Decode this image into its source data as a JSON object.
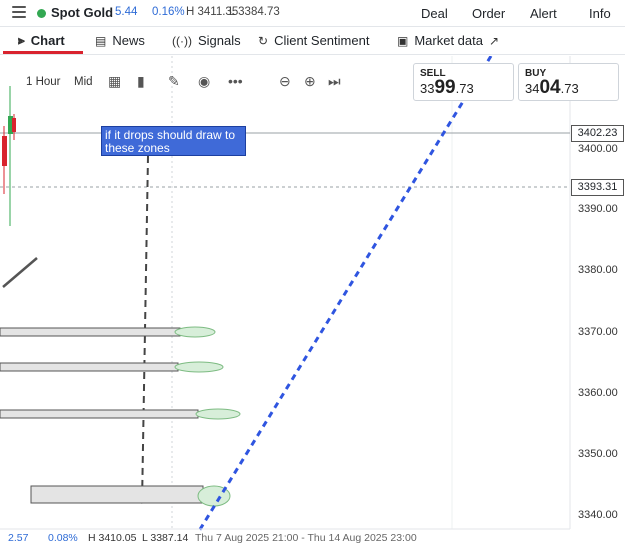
{
  "header": {
    "instrument": "Spot Gold",
    "change": "5.44",
    "change_pct": "0.16%",
    "high": "H 3411.35",
    "low": "L 3384.73",
    "actions": [
      "Deal",
      "Order",
      "Alert",
      "Info"
    ]
  },
  "tabs": [
    {
      "label": "Chart",
      "icon": "chart-bars-icon"
    },
    {
      "label": "News",
      "icon": "news-icon"
    },
    {
      "label": "Signals",
      "icon": "signal-icon"
    },
    {
      "label": "Client Sentiment",
      "icon": "sentiment-icon"
    },
    {
      "label": "Market data",
      "icon": "market-data-icon",
      "external": "↗"
    }
  ],
  "toolbar": {
    "timeframe": "1 Hour",
    "price_type": "Mid"
  },
  "sell": {
    "label": "SELL",
    "prefix": "33",
    "big": "99",
    "suffix": ".73"
  },
  "buy": {
    "label": "BUY",
    "prefix": "34",
    "big": "04",
    "suffix": ".73"
  },
  "annotation": "if it drops should draw to these zones",
  "price_axis": [
    "3400.00",
    "3390.00",
    "3380.00",
    "3370.00",
    "3360.00",
    "3350.00",
    "3340.00"
  ],
  "price_tags": {
    "current": "3402.23",
    "crosshair": "3393.31"
  },
  "footer": {
    "change": "2.57",
    "change_pct": "0.08%",
    "high": "H 3410.05",
    "low": "L 3387.14",
    "range": "Thu 7 Aug 2025 21:00 - Thu 14 Aug 2025 23:00"
  },
  "colors": {
    "accent": "#d9232e",
    "link": "#2e6bd6",
    "annotation": "#3f6ad8",
    "trendline": "#2f55e0"
  }
}
